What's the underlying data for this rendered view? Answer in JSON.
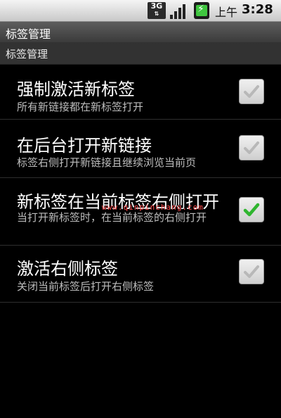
{
  "status_bar": {
    "network_label": "3G",
    "am_pm": "上午",
    "time": "3:28"
  },
  "title_bar": {
    "title": "标签管理"
  },
  "category": {
    "label": "标签管理"
  },
  "preferences": [
    {
      "title": "强制激活新标签",
      "summary": "所有新链接都在新标签打开",
      "checked": false
    },
    {
      "title": "在后台打开新链接",
      "summary": "标签右侧打开新链接且继续浏览当前页",
      "checked": false
    },
    {
      "title": "新标签在当前标签右侧打开",
      "summary": "当打开新标签时，在当前标签的右侧打开",
      "checked": true
    },
    {
      "title": "激活右侧标签",
      "summary": "关闭当前标签后打开右侧标签",
      "checked": false
    }
  ],
  "watermark": "www.qinpinchang.com",
  "colors": {
    "check_on": "#2fb52f",
    "check_off": "#b8b8b8"
  }
}
